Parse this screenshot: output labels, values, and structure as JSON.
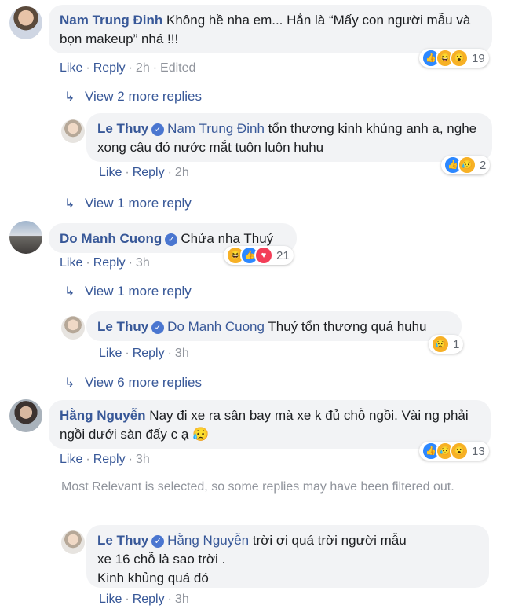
{
  "actions": {
    "like": "Like",
    "reply": "Reply",
    "edited": "Edited"
  },
  "comments": [
    {
      "author": "Nam Trung Đinh",
      "text": "Không hề nha em... Hẳn là “Mấy con người mẫu và bọn makeup” nhá !!!",
      "time": "2h",
      "reactions": "19"
    },
    {
      "author": "Do Manh Cuong",
      "text": "Chửa nha Thuý",
      "time": "3h",
      "reactions": "21"
    },
    {
      "author": "Hằng Nguyễn",
      "text": "Nay đi xe ra sân bay mà xe k đủ chỗ ngồi. Vài ng phải ngồi dưới sàn đấy c ạ 😥",
      "time": "3h",
      "reactions": "13"
    }
  ],
  "replies": [
    {
      "author": "Le Thuy",
      "mention": "Nam Trung Đinh",
      "text": " tổn thương kinh khủng anh a, nghe xong câu đó nước mắt tuôn luôn huhu",
      "time": "2h",
      "reactions": "2"
    },
    {
      "author": "Le Thuy",
      "mention": "Do Manh Cuong",
      "text": " Thuý tổn thương quá huhu",
      "time": "3h",
      "reactions": "1"
    },
    {
      "author": "Le Thuy",
      "mention": "Hằng Nguyễn",
      "text": " trời ơi quá trời người mẫu xe 16 chỗ là sao trời .",
      "text2": "Kinh khủng quá đó",
      "time": "3h"
    }
  ],
  "view_more": [
    "View 2 more replies",
    "View 1 more reply",
    "View 1 more reply",
    "View 6 more replies"
  ],
  "notice": "Most Relevant is selected, so some replies may have been filtered out.",
  "icons": {
    "verified": "✓",
    "reply_arrow": "↳"
  }
}
